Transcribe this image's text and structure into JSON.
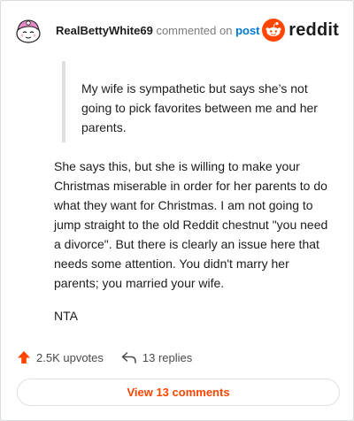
{
  "header": {
    "username": "RealBettyWhite69",
    "action_text": "commented on",
    "post_link": "post",
    "logo_text": "reddit"
  },
  "quote": {
    "text": "My wife is sympathetic but says she’s not going to pick favorites between me and her parents."
  },
  "comment": {
    "paragraphs": [
      "She says this, but she is willing to make your Christmas miserable in order for her parents to do what they want for Christmas. I am not going to jump straight to the old Reddit chestnut \"you need a divorce\". But there is clearly an issue here that needs some attention. You didn't marry her parents; you married your wife.",
      "NTA"
    ]
  },
  "actions": {
    "upvotes": "2.5K upvotes",
    "replies": "13 replies"
  },
  "footer": {
    "view_comments": "View 13 comments"
  },
  "colors": {
    "accent": "#ff4500",
    "link": "#0079d3"
  }
}
